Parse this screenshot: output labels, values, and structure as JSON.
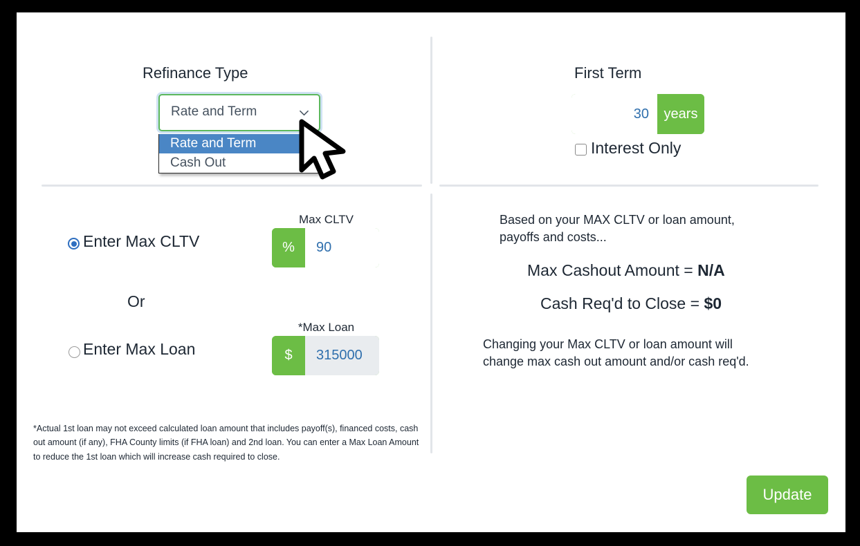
{
  "refinance": {
    "title": "Refinance Type",
    "selected": "Rate and Term",
    "options": [
      "Rate and Term",
      "Cash Out"
    ],
    "chevron_icon": "chevron-down-icon"
  },
  "first_term": {
    "title": "First Term",
    "value": "30",
    "suffix": "years",
    "interest_only_label": "Interest Only",
    "interest_only_checked": false
  },
  "amount_mode": {
    "cltv_option_label": "Enter Max CLTV",
    "or_label": "Or",
    "loan_option_label": "Enter Max Loan",
    "selected": "cltv",
    "cltv": {
      "label": "Max CLTV",
      "prefix": "%",
      "value": "90"
    },
    "loan": {
      "label": "*Max Loan",
      "prefix": "$",
      "value": "315000"
    }
  },
  "results": {
    "intro": "Based on your MAX CLTV or loan amount, payoffs and costs...",
    "max_cashout_label": "Max Cashout Amount = ",
    "max_cashout_value": "N/A",
    "cash_required_label": "Cash Req'd to Close = ",
    "cash_required_value": "$0",
    "note": "Changing your Max CLTV or loan amount will change max cash out amount and/or cash req'd."
  },
  "footnote": "*Actual 1st loan may not exceed calculated loan amount that includes payoff(s), financed costs, cash out amount (if any), FHA County limits (if FHA loan) and 2nd loan. You can enter a Max Loan Amount to reduce the 1st loan which will increase cash required to close.",
  "update_button": "Update",
  "colors": {
    "green": "#6cbd45",
    "blue_text": "#2f6fad",
    "highlight_blue": "#4a86c5",
    "divider": "#e2e5e9"
  }
}
